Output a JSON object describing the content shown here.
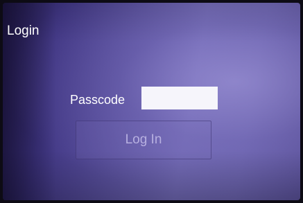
{
  "screen": {
    "title": "Login",
    "passcode_label": "Passcode",
    "passcode_value": "",
    "login_button_label": "Log In"
  },
  "colors": {
    "background_dark": "#2a2058",
    "background_light": "#6f67b3",
    "button_text": "#b7b0e0",
    "input_bg": "#f6f5fb"
  }
}
